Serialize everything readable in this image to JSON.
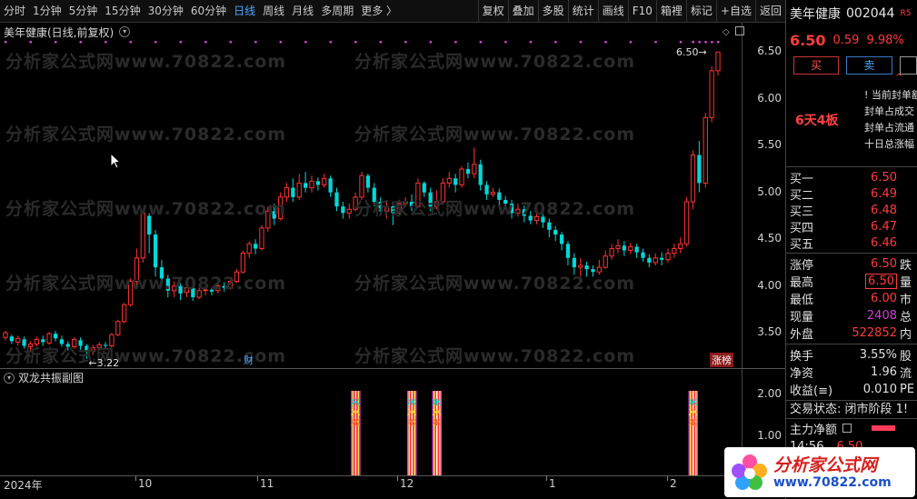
{
  "toolbar": {
    "periods": [
      "分时",
      "1分钟",
      "5分钟",
      "15分钟",
      "30分钟",
      "60分钟",
      "日线",
      "周线",
      "月线",
      "多周期",
      "更多 〉"
    ],
    "active_period": "日线",
    "buttons": [
      "复权",
      "叠加",
      "多股",
      "统计",
      "画线",
      "F10",
      "箱裡",
      "标记",
      "+自选",
      "返回"
    ]
  },
  "main_chart": {
    "title": "美年健康(日线,前复权)",
    "max_label": "6.50",
    "min_label": "3.22",
    "badge_cai": "财",
    "badge_zhangbang": "涨榜",
    "price_ticks": [
      "6.50",
      "6.00",
      "5.50",
      "5.00",
      "4.50",
      "4.00",
      "3.50"
    ],
    "watermark": "分析家公式网www.70822.com"
  },
  "sub_chart": {
    "title": "双龙共振副图",
    "ticks": [
      "2.00",
      "1.00"
    ]
  },
  "date_axis": {
    "labels": [
      "2024年",
      "10",
      "11",
      "12",
      "1",
      "2"
    ]
  },
  "chart_data": {
    "type": "candlestick",
    "title": "美年健康(日线,前复权)",
    "ylim": [
      3.2,
      6.6
    ],
    "up_color": "#ff3232",
    "down_color": "#00d8d8",
    "candles": [
      [
        3.45,
        3.5,
        3.42,
        3.52
      ],
      [
        3.46,
        3.41,
        3.38,
        3.48
      ],
      [
        3.4,
        3.44,
        3.36,
        3.47
      ],
      [
        3.43,
        3.36,
        3.33,
        3.46
      ],
      [
        3.35,
        3.38,
        3.3,
        3.41
      ],
      [
        3.38,
        3.43,
        3.35,
        3.46
      ],
      [
        3.43,
        3.4,
        3.36,
        3.47
      ],
      [
        3.39,
        3.49,
        3.37,
        3.51
      ],
      [
        3.49,
        3.44,
        3.41,
        3.52
      ],
      [
        3.43,
        3.38,
        3.35,
        3.47
      ],
      [
        3.38,
        3.35,
        3.31,
        3.41
      ],
      [
        3.35,
        3.43,
        3.33,
        3.45
      ],
      [
        3.42,
        3.36,
        3.32,
        3.45
      ],
      [
        3.36,
        3.3,
        3.22,
        3.38
      ],
      [
        3.3,
        3.34,
        3.26,
        3.37
      ],
      [
        3.34,
        3.37,
        3.31,
        3.4
      ],
      [
        3.37,
        3.36,
        3.32,
        3.4
      ],
      [
        3.36,
        3.48,
        3.34,
        3.5
      ],
      [
        3.48,
        3.62,
        3.46,
        3.64
      ],
      [
        3.62,
        3.8,
        3.6,
        3.82
      ],
      [
        3.8,
        4.05,
        3.78,
        4.08
      ],
      [
        4.05,
        4.3,
        4.0,
        4.4
      ],
      [
        4.3,
        4.78,
        4.25,
        4.8
      ],
      [
        4.75,
        4.55,
        4.35,
        4.78
      ],
      [
        4.55,
        4.2,
        4.1,
        4.6
      ],
      [
        4.2,
        4.08,
        4.0,
        4.28
      ],
      [
        4.08,
        3.95,
        3.88,
        4.12
      ],
      [
        3.95,
        4.0,
        3.88,
        4.05
      ],
      [
        4.0,
        3.92,
        3.85,
        4.03
      ],
      [
        3.93,
        3.98,
        3.88,
        4.02
      ],
      [
        3.98,
        3.88,
        3.84,
        4.0
      ],
      [
        3.88,
        3.95,
        3.86,
        3.98
      ],
      [
        3.95,
        3.96,
        3.9,
        3.99
      ],
      [
        3.96,
        3.94,
        3.9,
        3.98
      ],
      [
        3.95,
        4.0,
        3.92,
        4.03
      ],
      [
        4.0,
        3.98,
        3.94,
        4.04
      ],
      [
        3.98,
        4.05,
        3.96,
        4.08
      ],
      [
        4.05,
        4.15,
        4.03,
        4.18
      ],
      [
        4.15,
        4.35,
        4.13,
        4.38
      ],
      [
        4.35,
        4.45,
        4.3,
        4.48
      ],
      [
        4.45,
        4.4,
        4.34,
        4.5
      ],
      [
        4.4,
        4.62,
        4.38,
        4.65
      ],
      [
        4.62,
        4.8,
        4.58,
        4.85
      ],
      [
        4.8,
        4.72,
        4.65,
        4.88
      ],
      [
        4.72,
        4.95,
        4.7,
        5.0
      ],
      [
        4.95,
        5.05,
        4.9,
        5.1
      ],
      [
        5.05,
        4.95,
        4.9,
        5.15
      ],
      [
        4.95,
        5.1,
        4.92,
        5.2
      ],
      [
        5.1,
        5.05,
        5.0,
        5.22
      ],
      [
        5.05,
        5.12,
        5.0,
        5.18
      ],
      [
        5.12,
        5.08,
        5.02,
        5.16
      ],
      [
        5.08,
        5.15,
        5.05,
        5.2
      ],
      [
        5.15,
        5.0,
        4.95,
        5.18
      ],
      [
        5.0,
        4.85,
        4.8,
        5.05
      ],
      [
        4.85,
        4.78,
        4.72,
        4.9
      ],
      [
        4.78,
        4.82,
        4.72,
        4.88
      ],
      [
        4.82,
        4.95,
        4.8,
        5.0
      ],
      [
        4.95,
        5.18,
        4.92,
        5.22
      ],
      [
        5.18,
        5.05,
        5.0,
        5.2
      ],
      [
        5.05,
        4.9,
        4.85,
        5.1
      ],
      [
        4.9,
        4.8,
        4.75,
        4.95
      ],
      [
        4.8,
        4.85,
        4.72,
        4.92
      ],
      [
        4.85,
        4.78,
        4.65,
        4.9
      ],
      [
        4.78,
        4.88,
        4.75,
        4.92
      ],
      [
        4.88,
        4.9,
        4.85,
        4.95
      ],
      [
        4.9,
        4.85,
        4.8,
        4.98
      ],
      [
        4.85,
        5.1,
        4.83,
        5.15
      ],
      [
        5.1,
        5.0,
        4.95,
        5.12
      ],
      [
        5.0,
        4.85,
        4.8,
        5.05
      ],
      [
        4.85,
        4.9,
        4.82,
        5.02
      ],
      [
        4.9,
        5.1,
        4.88,
        5.15
      ],
      [
        5.1,
        5.15,
        5.05,
        5.22
      ],
      [
        5.15,
        5.08,
        5.0,
        5.2
      ],
      [
        5.08,
        5.25,
        5.05,
        5.28
      ],
      [
        5.25,
        5.2,
        5.15,
        5.32
      ],
      [
        5.2,
        5.3,
        5.15,
        5.48
      ],
      [
        5.3,
        5.08,
        5.02,
        5.35
      ],
      [
        5.08,
        4.98,
        4.92,
        5.12
      ],
      [
        4.98,
        5.0,
        4.95,
        5.05
      ],
      [
        5.0,
        4.92,
        4.86,
        5.04
      ],
      [
        4.92,
        4.88,
        4.82,
        4.96
      ],
      [
        4.88,
        4.78,
        4.72,
        4.92
      ],
      [
        4.78,
        4.82,
        4.74,
        4.88
      ],
      [
        4.82,
        4.75,
        4.68,
        4.86
      ],
      [
        4.75,
        4.7,
        4.66,
        4.8
      ],
      [
        4.7,
        4.74,
        4.66,
        4.78
      ],
      [
        4.74,
        4.68,
        4.62,
        4.77
      ],
      [
        4.68,
        4.6,
        4.52,
        4.72
      ],
      [
        4.6,
        4.55,
        4.48,
        4.64
      ],
      [
        4.55,
        4.45,
        4.38,
        4.58
      ],
      [
        4.45,
        4.3,
        4.22,
        4.48
      ],
      [
        4.3,
        4.2,
        4.12,
        4.35
      ],
      [
        4.2,
        4.22,
        4.1,
        4.3
      ],
      [
        4.22,
        4.18,
        4.1,
        4.26
      ],
      [
        4.18,
        4.15,
        4.1,
        4.22
      ],
      [
        4.15,
        4.2,
        4.12,
        4.28
      ],
      [
        4.2,
        4.32,
        4.18,
        4.38
      ],
      [
        4.32,
        4.4,
        4.28,
        4.45
      ],
      [
        4.4,
        4.43,
        4.35,
        4.5
      ],
      [
        4.43,
        4.38,
        4.32,
        4.48
      ],
      [
        4.38,
        4.42,
        4.34,
        4.46
      ],
      [
        4.42,
        4.36,
        4.3,
        4.45
      ],
      [
        4.36,
        4.3,
        4.26,
        4.4
      ],
      [
        4.3,
        4.25,
        4.2,
        4.34
      ],
      [
        4.25,
        4.3,
        4.22,
        4.35
      ],
      [
        4.3,
        4.28,
        4.22,
        4.36
      ],
      [
        4.28,
        4.35,
        4.25,
        4.4
      ],
      [
        4.35,
        4.4,
        4.3,
        4.45
      ],
      [
        4.4,
        4.45,
        4.35,
        4.52
      ],
      [
        4.45,
        4.9,
        4.42,
        4.95
      ],
      [
        4.9,
        5.4,
        4.82,
        5.45
      ],
      [
        5.4,
        5.1,
        5.0,
        5.55
      ],
      [
        5.1,
        5.8,
        5.05,
        5.85
      ],
      [
        5.8,
        6.3,
        5.75,
        6.35
      ],
      [
        6.3,
        6.5,
        6.25,
        6.5
      ]
    ],
    "signals_at_index": [
      56,
      65,
      69,
      110
    ],
    "signal_colors": [
      "#ff3232",
      "#ffe040",
      "#d040d0",
      "#00d8d8"
    ]
  },
  "quote": {
    "name": "美年健康",
    "code": "002044",
    "tiny": "R5",
    "price": "6.50",
    "change": "0.59",
    "pct": "9.98%",
    "buy_label": "买",
    "sell_label": "卖",
    "limit_tag": "6天4板",
    "limit_lines": [
      "! 当前封单额",
      "封单占成交",
      "封单占流通",
      "十日总涨幅"
    ],
    "orderbook": [
      {
        "label": "买一",
        "price": "6.50"
      },
      {
        "label": "买二",
        "price": "6.49"
      },
      {
        "label": "买三",
        "price": "6.48"
      },
      {
        "label": "买四",
        "price": "6.47"
      },
      {
        "label": "买五",
        "price": "6.46"
      }
    ],
    "stats": [
      {
        "label": "涨停",
        "value": "6.50",
        "color": "red",
        "extra": "跌"
      },
      {
        "label": "最高",
        "value": "6.50",
        "color": "red",
        "extra": "量",
        "boxed": true
      },
      {
        "label": "最低",
        "value": "6.00",
        "color": "red",
        "extra": "市"
      },
      {
        "label": "现量",
        "value": "2408",
        "color": "purple",
        "extra": "总"
      },
      {
        "label": "外盘",
        "value": "522852",
        "color": "red",
        "extra": "内"
      }
    ],
    "stats2": [
      {
        "label": "换手",
        "value": "3.55%",
        "extra": "股"
      },
      {
        "label": "净资",
        "value": "1.96",
        "extra": "流"
      },
      {
        "label": "收益(≡)",
        "value": "0.010",
        "extra": "PE"
      }
    ],
    "status": "交易状态: 闭市阶段 1!",
    "mainflow_label": "主力净额",
    "tick_time": "14:56",
    "tick_price": "6.50"
  },
  "logo": {
    "main": "分析家公式网",
    "url": "www.70822.com"
  }
}
